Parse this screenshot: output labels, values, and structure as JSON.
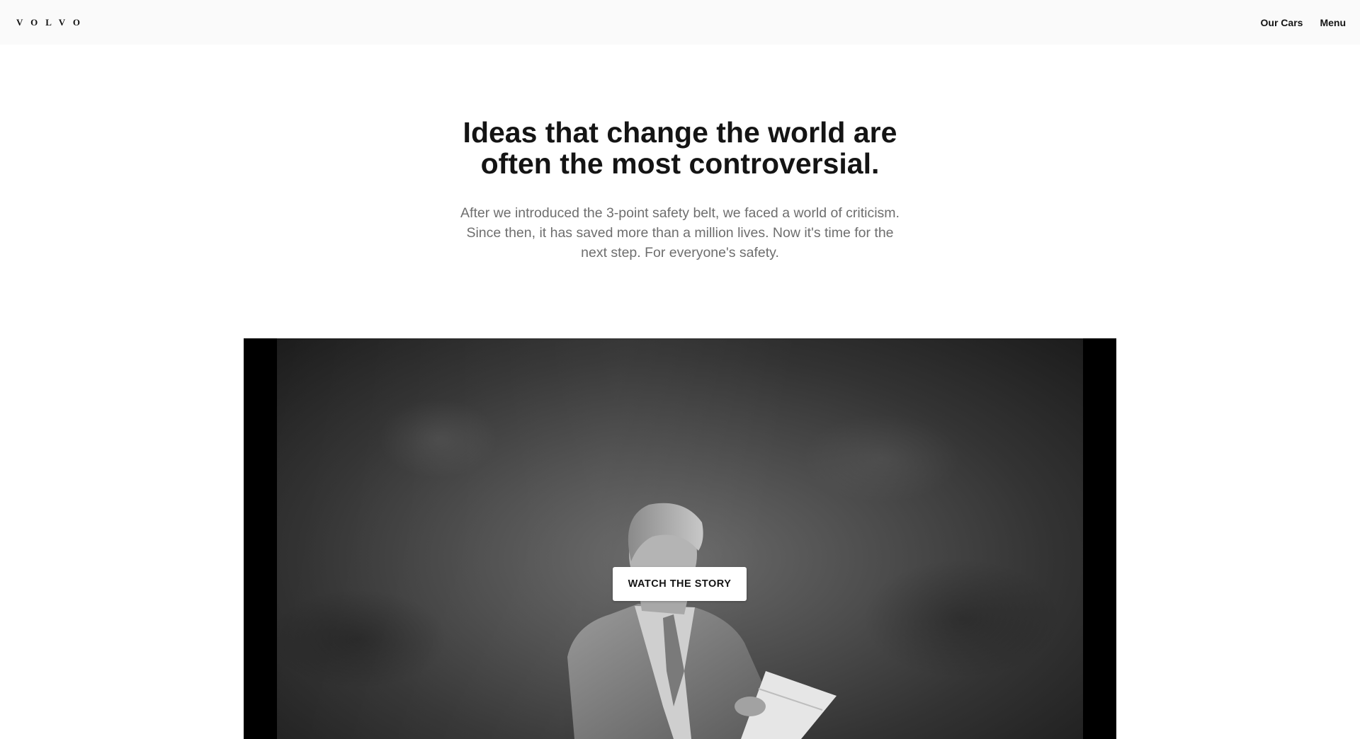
{
  "header": {
    "logo_text": "VOLVO",
    "nav": [
      {
        "label": "Our Cars"
      },
      {
        "label": "Menu"
      }
    ]
  },
  "hero": {
    "headline": "Ideas that change the world are often the most controversial.",
    "body": "After we introduced the 3-point safety belt, we faced a world of criticism. Since then, it has saved more than a million lives. Now it's time for the next step. For everyone's safety."
  },
  "video": {
    "cta_label": "WATCH THE STORY"
  },
  "colors": {
    "header_bg": "#fafafa",
    "text_dark": "#141414",
    "text_muted": "#6e6e6e"
  }
}
